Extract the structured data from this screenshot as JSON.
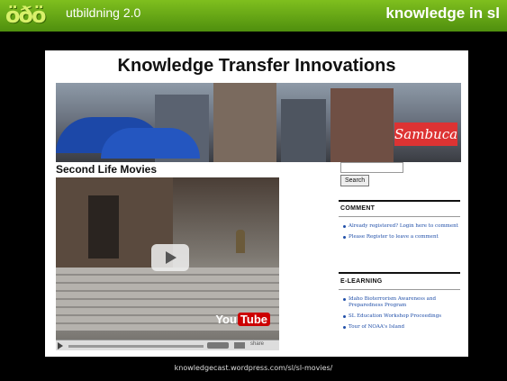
{
  "slide": {
    "logo_text": "öðö",
    "brand": "utbildning 2.0",
    "title": "knowledge in sl",
    "caption": "knowledgecast.wordpress.com/sl/sl-movies/"
  },
  "site": {
    "title": "Knowledge Transfer Innovations",
    "banner_sign": "Sambuca",
    "section_heading": "Second Life Movies"
  },
  "video": {
    "youtube_label_you": "You",
    "youtube_label_tube": "Tube",
    "share_label": "share"
  },
  "sidebar": {
    "search_button": "Search",
    "comment": {
      "title": "COMMENT",
      "items": [
        "Already registered? Login here to comment",
        "Please Register to leave a comment"
      ]
    },
    "elearning": {
      "title": "E-LEARNING",
      "items": [
        "Idaho Bioterrorism Awareness and Preparedness Program",
        "SL Education Workshop Proceedings",
        "Tour of NOAA's Island"
      ]
    }
  },
  "colors": {
    "header_green": "#6aad18",
    "link_blue": "#1f4ea8"
  }
}
